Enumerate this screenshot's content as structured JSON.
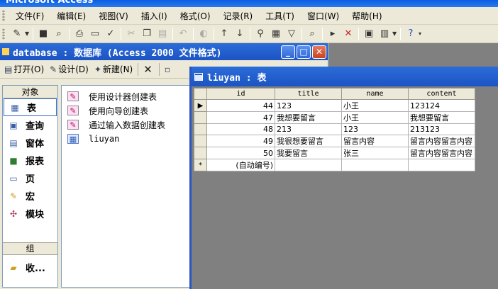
{
  "app": {
    "title": "Microsoft Access"
  },
  "menu": [
    "文件(F)",
    "编辑(E)",
    "视图(V)",
    "插入(I)",
    "格式(O)",
    "记录(R)",
    "工具(T)",
    "窗口(W)",
    "帮助(H)"
  ],
  "db_window": {
    "title": "database : 数据库 (Access 2000 文件格式)",
    "toolbar": {
      "open": "打开(O)",
      "design": "设计(D)",
      "new": "新建(N)"
    },
    "objects_header": "对象",
    "objects": [
      "表",
      "查询",
      "窗体",
      "报表",
      "页",
      "宏",
      "模块"
    ],
    "groups_header": "组",
    "favorites": "收...",
    "list": [
      {
        "label": "使用设计器创建表",
        "icon": "wizard-icon"
      },
      {
        "label": "使用向导创建表",
        "icon": "wizard-icon"
      },
      {
        "label": "通过输入数据创建表",
        "icon": "wizard-icon"
      },
      {
        "label": "liuyan",
        "icon": "table-icon"
      }
    ]
  },
  "table_window": {
    "title": "liuyan : 表",
    "columns": [
      "id",
      "title",
      "name",
      "content"
    ],
    "rows": [
      {
        "selector": "▶",
        "id": "44",
        "title": "123",
        "name": "小王",
        "content": "123124"
      },
      {
        "selector": "",
        "id": "47",
        "title": "我想要留言",
        "name": "小王",
        "content": "我想要留言"
      },
      {
        "selector": "",
        "id": "48",
        "title": "213",
        "name": "123",
        "content": "213123"
      },
      {
        "selector": "",
        "id": "49",
        "title": "我很想要留言",
        "name": "留言内容",
        "content": "留言内容留言内容"
      },
      {
        "selector": "",
        "id": "50",
        "title": "我要留言",
        "name": "张三",
        "content": "留言内容留言内容"
      }
    ],
    "new_row": {
      "selector": "*",
      "id": "(自动编号)"
    }
  }
}
